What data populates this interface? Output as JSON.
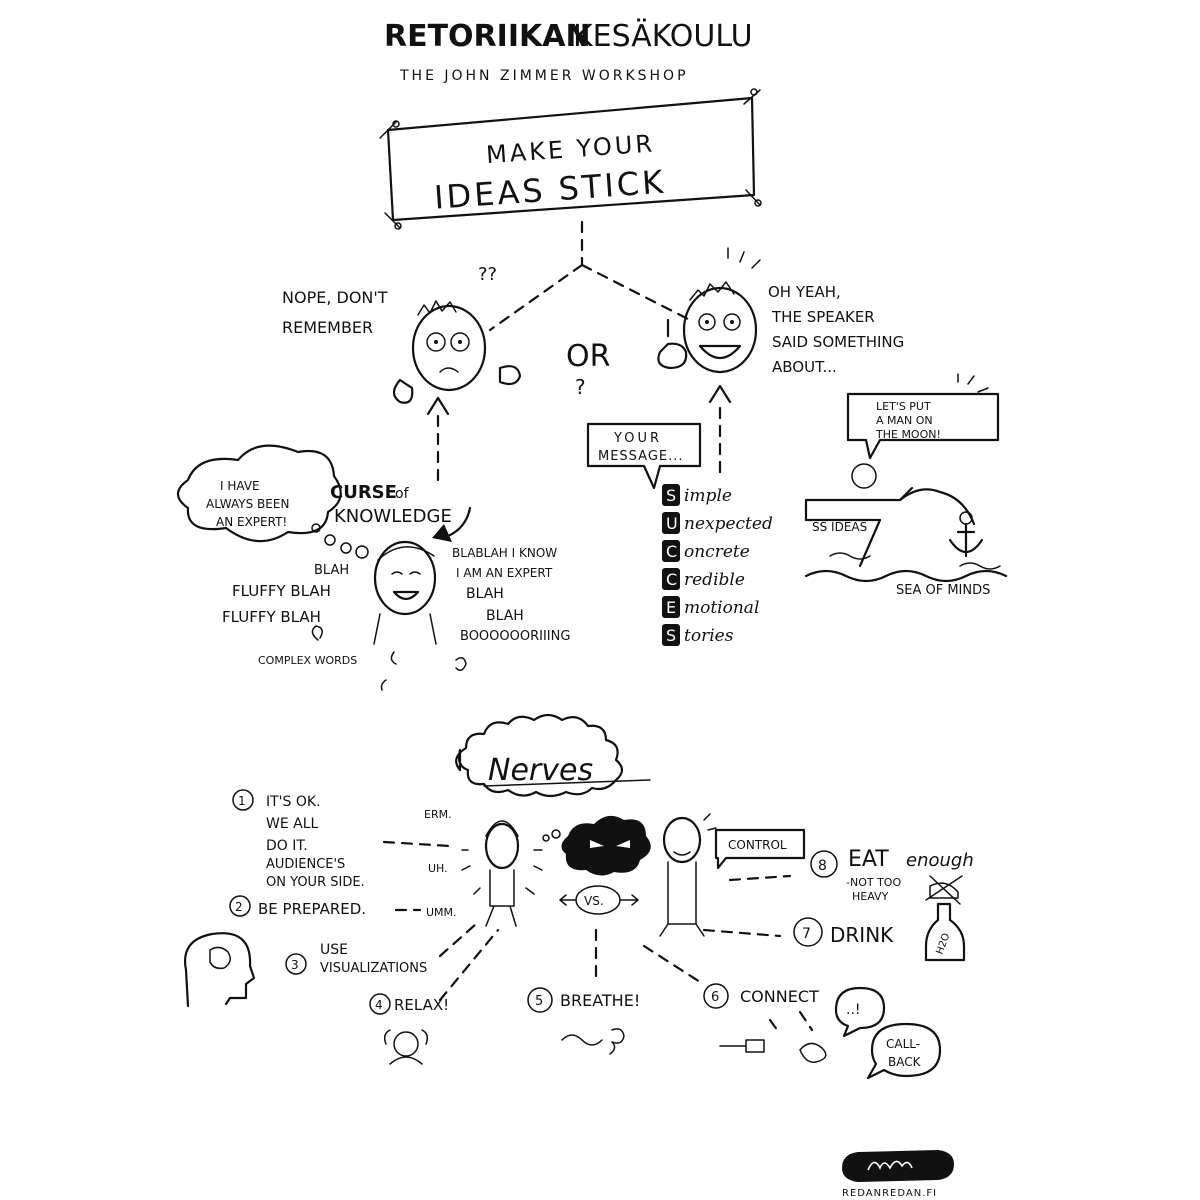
{
  "header": {
    "brand_bold": "RETORIIKAN",
    "brand_light": "KESÄKOULU",
    "subtitle": "THE JOHN ZIMMER WORKSHOP"
  },
  "banner": {
    "line1": "MAKE YOUR",
    "line2": "IDEAS STICK"
  },
  "left_face": {
    "question": "??",
    "line1": "NOPE, DON'T",
    "line2": "REMEMBER"
  },
  "or_label": "OR",
  "or_question": "?",
  "right_face": {
    "line1": "OH YEAH,",
    "line2": "THE SPEAKER",
    "line3": "SAID SOMETHING",
    "line4": "ABOUT..."
  },
  "curse": {
    "thought_line1": "I HAVE",
    "thought_line2": "ALWAYS BEEN",
    "thought_line3": "AN EXPERT!",
    "title_bold": "CURSE",
    "title_of": "of",
    "title_line2": "KNOWLEDGE",
    "words": [
      "BLAH",
      "FLUFFY  BLAH",
      "FLUFFY  BLAH",
      "BLABLAH I KNOW",
      "I AM AN EXPERT",
      "BLAH",
      "BLAH",
      "BOOOOOORIIING",
      "COMPLEX WORDS"
    ]
  },
  "message_box": {
    "line1": "YOUR",
    "line2": "MESSAGE..."
  },
  "success": [
    {
      "letter": "S",
      "rest": "imple"
    },
    {
      "letter": "U",
      "rest": "nexpected"
    },
    {
      "letter": "C",
      "rest": "oncrete"
    },
    {
      "letter": "C",
      "rest": "redible"
    },
    {
      "letter": "E",
      "rest": "motional"
    },
    {
      "letter": "S",
      "rest": "tories"
    }
  ],
  "moon": {
    "bubble_line1": "LET'S PUT",
    "bubble_line2": "A MAN ON",
    "bubble_line3": "THE MOON!",
    "ship_label": "SS IDEAS",
    "sea_label": "SEA OF MINDS"
  },
  "nerves": {
    "title": "Nerves",
    "tips": {
      "t1_num": "1",
      "t1_lines": [
        "IT'S OK.",
        "WE ALL",
        "DO IT.",
        "AUDIENCE'S",
        "ON YOUR SIDE."
      ],
      "t2_num": "2",
      "t2": "BE PREPARED.",
      "t3_num": "3",
      "t3_line1": "USE",
      "t3_line2": "VISUALIZATIONS",
      "t4_num": "4",
      "t4": "RELAX!",
      "t5_num": "5",
      "t5": "BREATHE!",
      "t6_num": "6",
      "t6": "CONNECT",
      "t7_num": "7",
      "t7": "DRINK",
      "t8_num": "8",
      "t8_bold": "EAT",
      "t8_script": "enough",
      "t8_sub1": "-NOT TOO",
      "t8_sub2": "HEAVY"
    },
    "fillers": [
      "ERM.",
      "UH.",
      "UMM."
    ],
    "vs": "VS.",
    "control": "CONTROL",
    "bottle_label": "H2O",
    "bubble_dots": "..!",
    "callback_line1": "CALL-",
    "callback_line2": "BACK"
  },
  "footer": {
    "site": "REDANREDAN.FI"
  }
}
